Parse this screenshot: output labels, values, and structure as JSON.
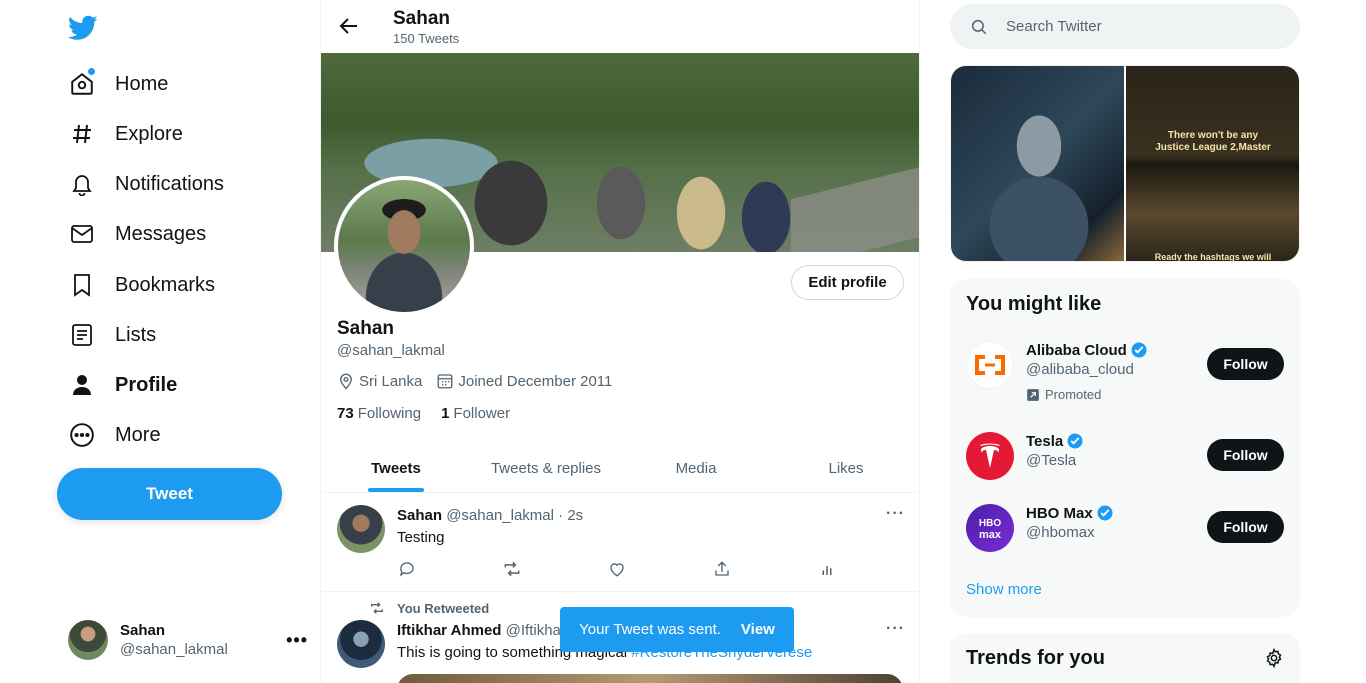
{
  "nav": {
    "items": [
      {
        "label": "Home",
        "icon": "home-icon"
      },
      {
        "label": "Explore",
        "icon": "hashtag-icon"
      },
      {
        "label": "Notifications",
        "icon": "bell-icon"
      },
      {
        "label": "Messages",
        "icon": "envelope-icon"
      },
      {
        "label": "Bookmarks",
        "icon": "bookmark-icon"
      },
      {
        "label": "Lists",
        "icon": "list-icon"
      },
      {
        "label": "Profile",
        "icon": "person-icon"
      },
      {
        "label": "More",
        "icon": "more-circle-icon"
      }
    ],
    "tweet_button": "Tweet",
    "account": {
      "name": "Sahan",
      "handle": "@sahan_lakmal"
    }
  },
  "header": {
    "title": "Sahan",
    "tweet_count": "150 Tweets"
  },
  "profile": {
    "edit_button": "Edit profile",
    "name": "Sahan",
    "handle": "@sahan_lakmal",
    "location": "Sri Lanka",
    "joined": "Joined December 2011",
    "following_count": "73",
    "following_label": "Following",
    "followers_count": "1",
    "followers_label": "Follower"
  },
  "tabs": [
    "Tweets",
    "Tweets & replies",
    "Media",
    "Likes"
  ],
  "tweets": [
    {
      "name": "Sahan",
      "handle": "@sahan_lakmal",
      "time": "· 2s",
      "text": "Testing"
    },
    {
      "retweet_note": "You Retweeted",
      "name": "Iftikhar Ahmed",
      "handle": "@Iftikha",
      "text": "This is going to something magical ",
      "hashtag": "#RestoreTheSnyderVerese"
    }
  ],
  "toast": {
    "message": "Your Tweet was sent.",
    "action": "View"
  },
  "search": {
    "placeholder": "Search Twitter"
  },
  "media_caption": {
    "line1": "There won't be any",
    "line2": "Justice League 2,Master",
    "bottom": "Ready the hashtags we will"
  },
  "you_might_like": {
    "title": "You might like",
    "items": [
      {
        "name": "Alibaba Cloud",
        "handle": "@alibaba_cloud",
        "promoted": "Promoted",
        "button": "Follow"
      },
      {
        "name": "Tesla",
        "handle": "@Tesla",
        "button": "Follow"
      },
      {
        "name": "HBO Max",
        "handle": "@hbomax",
        "button": "Follow"
      }
    ],
    "show_more": "Show more"
  },
  "trends": {
    "title": "Trends for you"
  },
  "colors": {
    "accent": "#1d9bf0",
    "text": "#0f1419",
    "muted": "#536471"
  }
}
